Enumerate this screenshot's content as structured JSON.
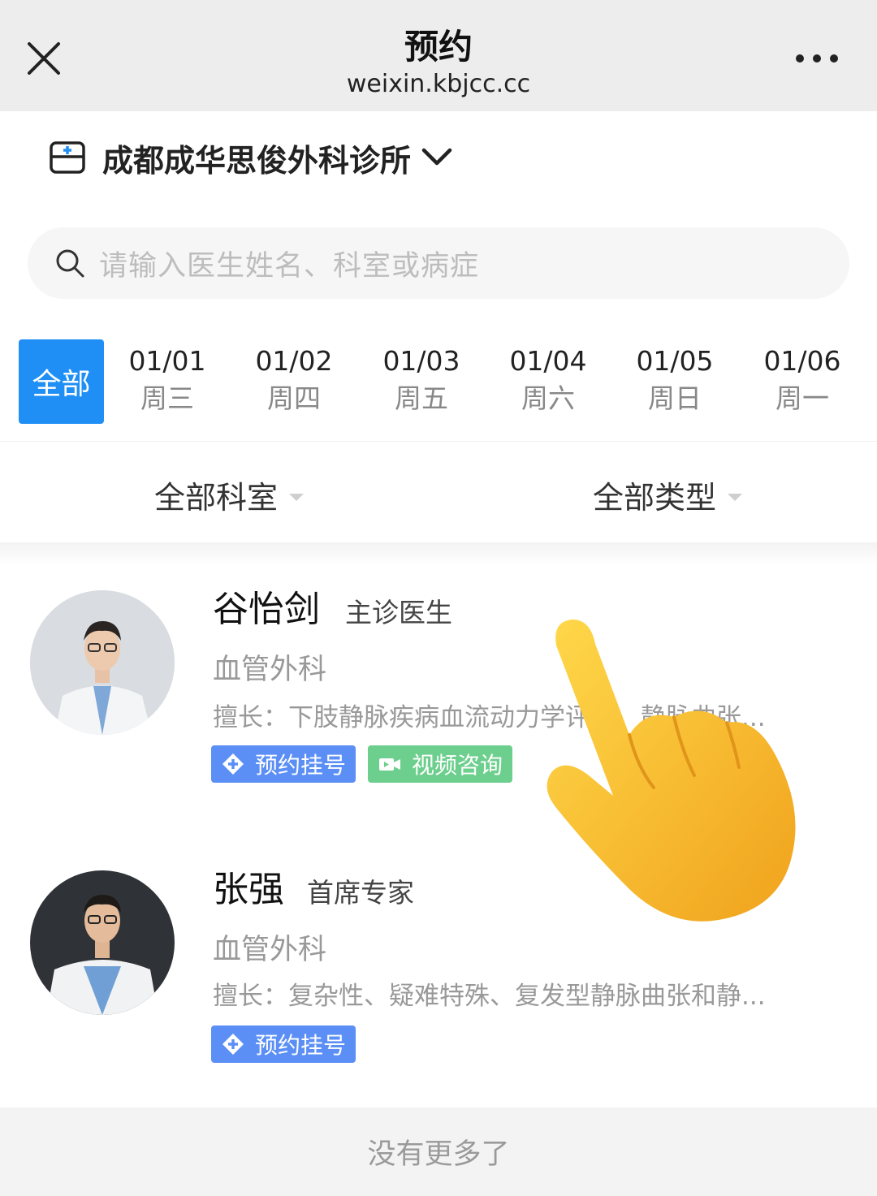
{
  "header": {
    "title": "预约",
    "url": "weixin.kbjcc.cc"
  },
  "clinic": {
    "name": "成都成华思俊外科诊所"
  },
  "search": {
    "placeholder": "请输入医生姓名、科室或病症"
  },
  "dates": {
    "all_label": "全部",
    "tabs": [
      {
        "date": "01/01",
        "weekday": "周三"
      },
      {
        "date": "01/02",
        "weekday": "周四"
      },
      {
        "date": "01/03",
        "weekday": "周五"
      },
      {
        "date": "01/04",
        "weekday": "周六"
      },
      {
        "date": "01/05",
        "weekday": "周日"
      },
      {
        "date": "01/06",
        "weekday": "周一"
      }
    ]
  },
  "filters": {
    "department": "全部科室",
    "type": "全部类型"
  },
  "doctors": [
    {
      "name": "谷怡剑",
      "title": "主诊医生",
      "department": "血管外科",
      "specialty": "擅长：下肢静脉疾病血流动力学评估、静脉曲张...",
      "tags": [
        "预约挂号",
        "视频咨询"
      ]
    },
    {
      "name": "张强",
      "title": "首席专家",
      "department": "血管外科",
      "specialty": "擅长：复杂性、疑难特殊、复发型静脉曲张和静...",
      "tags": [
        "预约挂号"
      ]
    }
  ],
  "footer": {
    "text": "没有更多了"
  },
  "colors": {
    "accent": "#1f8ff6",
    "tag_blue": "#5b8ff5",
    "tag_green": "#6dcf8d"
  },
  "icons": [
    "close-icon",
    "more-icon",
    "clinic-icon",
    "chevron-down-icon",
    "search-icon",
    "plus-circle-icon",
    "video-icon",
    "pointing-hand-icon"
  ]
}
